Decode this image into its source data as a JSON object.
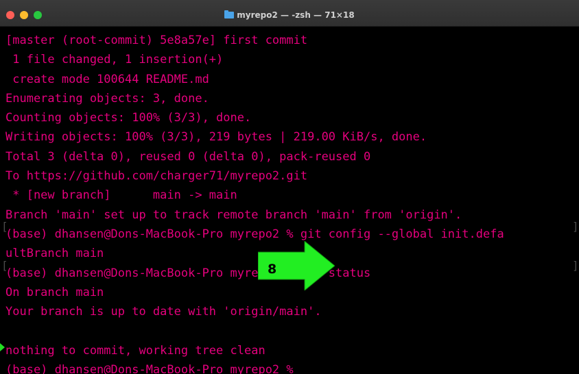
{
  "window": {
    "title": "myrepo2 — -zsh — 71×18",
    "title_icon": "folder-icon",
    "colors": {
      "text": "#e6007e",
      "background": "#000000",
      "annotation_arrow": "#22ee22"
    }
  },
  "terminal": {
    "lines": [
      "[master (root-commit) 5e8a57e] first commit",
      " 1 file changed, 1 insertion(+)",
      " create mode 100644 README.md",
      "Enumerating objects: 3, done.",
      "Counting objects: 100% (3/3), done.",
      "Writing objects: 100% (3/3), 219 bytes | 219.00 KiB/s, done.",
      "Total 3 (delta 0), reused 0 (delta 0), pack-reused 0",
      "To https://github.com/charger71/myrepo2.git",
      " * [new branch]      main -> main",
      "Branch 'main' set up to track remote branch 'main' from 'origin'.",
      "(base) dhansen@Dons-MacBook-Pro myrepo2 % git config --global init.defa",
      "ultBranch main",
      "(base) dhansen@Dons-MacBook-Pro myrepo2 % git status",
      "On branch main",
      "Your branch is up to date with 'origin/main'.",
      "",
      "nothing to commit, working tree clean",
      "(base) dhansen@Dons-MacBook-Pro myrepo2 % "
    ]
  },
  "annotation": {
    "step_number": "8",
    "icon": "right-arrow-icon"
  }
}
